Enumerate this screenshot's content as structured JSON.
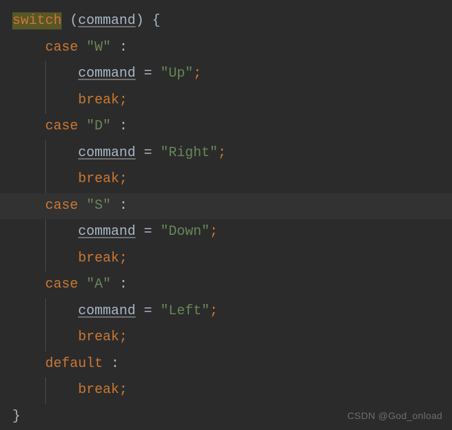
{
  "code": {
    "kw_switch": "switch",
    "var_command": "command",
    "kw_case": "case",
    "kw_break": "break",
    "kw_default": "default",
    "assign": "=",
    "colon": ":",
    "semi": ";",
    "lparen": "(",
    "rparen": ")",
    "lbrace": "{",
    "rbrace": "}",
    "cases": [
      {
        "match": "\"W\"",
        "value": "\"Up\""
      },
      {
        "match": "\"D\"",
        "value": "\"Right\""
      },
      {
        "match": "\"S\"",
        "value": "\"Down\""
      },
      {
        "match": "\"A\"",
        "value": "\"Left\""
      }
    ]
  },
  "watermark": "CSDN @God_onload"
}
